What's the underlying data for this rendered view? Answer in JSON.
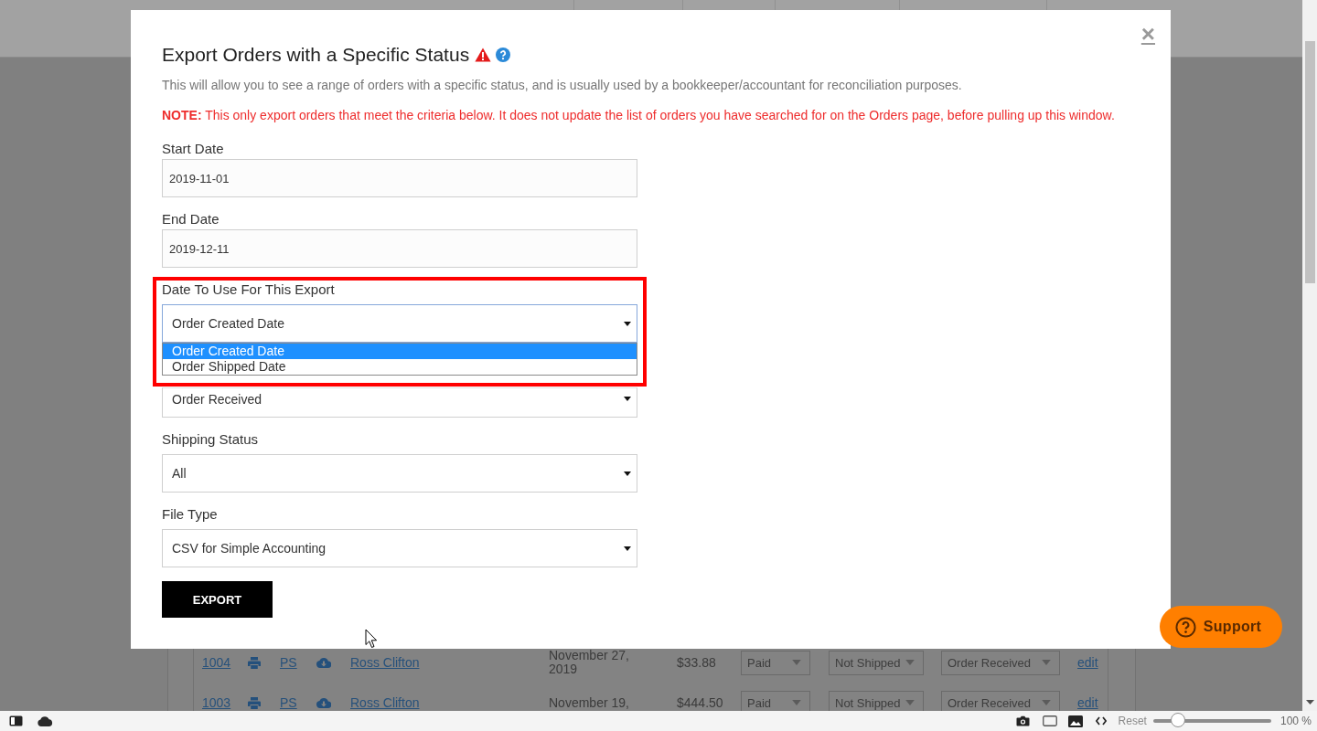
{
  "background_table": {
    "rows": [
      {
        "cells": [
          {
            "kind": "link",
            "text": "1004"
          },
          {
            "kind": "link",
            "text": "PS"
          },
          {
            "kind": "link",
            "text": "Ross Clifton"
          },
          {
            "kind": "text",
            "text": "November 27, 2019"
          },
          {
            "kind": "text",
            "text": "$33.88"
          },
          {
            "kind": "select",
            "text": "Paid"
          },
          {
            "kind": "select",
            "text": "Not Shipped"
          },
          {
            "kind": "select",
            "text": "Order Received"
          },
          {
            "kind": "link",
            "text": "edit"
          }
        ]
      },
      {
        "cells": [
          {
            "kind": "link",
            "text": "1003"
          },
          {
            "kind": "link",
            "text": "PS"
          },
          {
            "kind": "link",
            "text": "Ross Clifton"
          },
          {
            "kind": "text",
            "text": "November 19,"
          },
          {
            "kind": "text",
            "text": "$444.50"
          },
          {
            "kind": "select",
            "text": "Paid"
          },
          {
            "kind": "select",
            "text": "Not Shipped"
          },
          {
            "kind": "select",
            "text": "Order Received"
          },
          {
            "kind": "link",
            "text": "edit"
          }
        ]
      }
    ]
  },
  "dialog": {
    "title": "Export Orders with a Specific Status",
    "close": "×",
    "description": "This will allow you to see a range of orders with a specific status, and is usually used by a bookkeeper/accountant for reconciliation purposes.",
    "note": "**NOTE:** This only export orders that meet the criteria below. It does not update the list of orders you have searched for on the Orders page, before pulling up this window.",
    "fields": [
      {
        "kind": "text",
        "label": "Start Date",
        "value": "2019-11-01",
        "highlighted": false
      },
      {
        "kind": "text",
        "label": "End Date",
        "value": "2019-12-11",
        "highlighted": false
      },
      {
        "kind": "select",
        "label": "Date To Use For This Export",
        "value": "Order Created Date",
        "expanded": true,
        "highlighted": true,
        "options": [
          {
            "label": "Order Created Date",
            "selected": true
          },
          {
            "label": "Order Shipped Date",
            "selected": false
          }
        ]
      },
      {
        "kind": "select",
        "value": "Order Received",
        "expanded": false,
        "highlighted": false
      },
      {
        "kind": "select",
        "label": "Shipping Status",
        "value": "All",
        "expanded": false,
        "highlighted": false
      },
      {
        "kind": "select",
        "label": "File Type",
        "value": "CSV for Simple Accounting",
        "expanded": false,
        "highlighted": false
      }
    ],
    "button": "EXPORT"
  },
  "support_button": {
    "label": "Support"
  },
  "status_bar": {
    "reset": "Reset",
    "zoom_slider": {
      "level": 0.21
    },
    "zoom_reading": "100 %"
  }
}
